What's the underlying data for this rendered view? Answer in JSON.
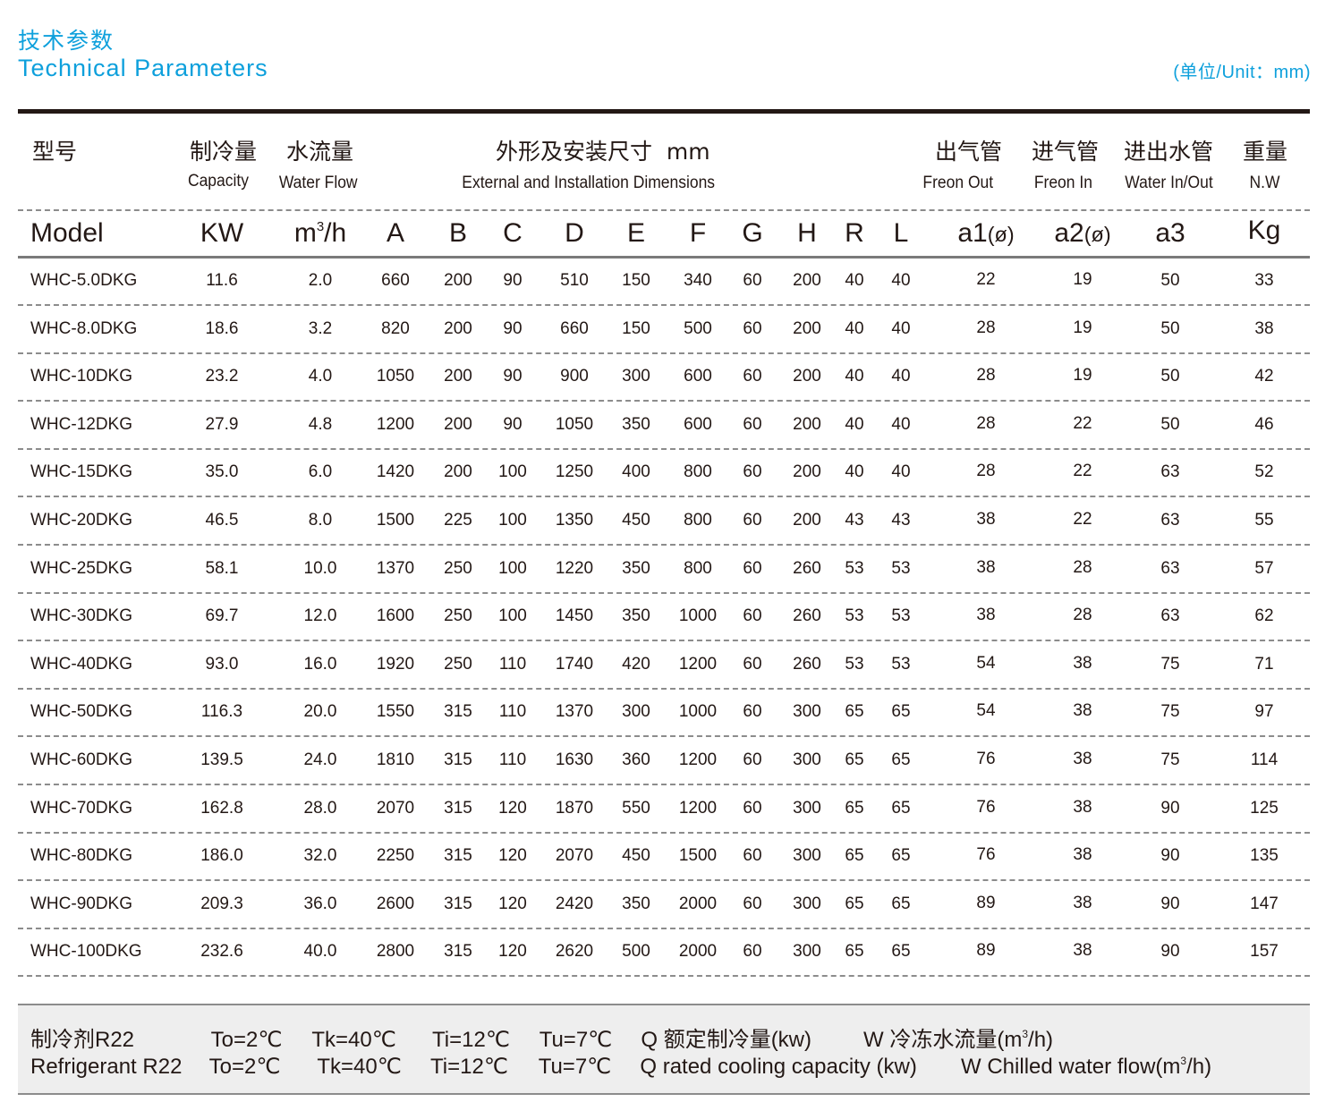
{
  "title": {
    "cn": "技术参数",
    "en": "Technical Parameters",
    "unit": "(单位/Unit：mm)"
  },
  "colors": {
    "accent": "#0ea0dc",
    "text": "#231815",
    "rule": "#231815",
    "divider": "#8c8c8c",
    "notes_bg": "#eeeeee"
  },
  "header": {
    "model_cn": "型号",
    "capacity_cn": "制冷量",
    "capacity_en": "Capacity",
    "waterflow_cn": "水流量",
    "waterflow_en": "Water Flow",
    "dimensions_cn": "外形及安装尺寸  mm",
    "dimensions_en": "External and Installation Dimensions",
    "freon_out_cn": "出气管",
    "freon_out_en": "Freon Out",
    "freon_in_cn": "进气管",
    "freon_in_en": "Freon In",
    "water_io_cn": "进出水管",
    "water_io_en": "Water In/Out",
    "weight_cn": "重量",
    "weight_en": "N.W",
    "symbols": {
      "model": "Model",
      "kw": "KW",
      "m3h_base": "m",
      "m3h_sup": "3",
      "m3h_tail": "/h",
      "A": "A",
      "B": "B",
      "C": "C",
      "D": "D",
      "E": "E",
      "F": "F",
      "G": "G",
      "H": "H",
      "R": "R",
      "L": "L",
      "a1": "a1",
      "a2": "a2",
      "phi": "(ø)",
      "a3": "a3",
      "kg": "Kg"
    }
  },
  "columns": [
    "Model",
    "KW",
    "m3/h",
    "A",
    "B",
    "C",
    "D",
    "E",
    "F",
    "G",
    "H",
    "R",
    "L",
    "a1(ø)",
    "a2(ø)",
    "a3",
    "Kg"
  ],
  "rows": [
    [
      "WHC-5.0DKG",
      "11.6",
      "2.0",
      "660",
      "200",
      "90",
      "510",
      "150",
      "340",
      "60",
      "200",
      "40",
      "40",
      "22",
      "19",
      "50",
      "33"
    ],
    [
      "WHC-8.0DKG",
      "18.6",
      "3.2",
      "820",
      "200",
      "90",
      "660",
      "150",
      "500",
      "60",
      "200",
      "40",
      "40",
      "28",
      "19",
      "50",
      "38"
    ],
    [
      "WHC-10DKG",
      "23.2",
      "4.0",
      "1050",
      "200",
      "90",
      "900",
      "300",
      "600",
      "60",
      "200",
      "40",
      "40",
      "28",
      "19",
      "50",
      "42"
    ],
    [
      "WHC-12DKG",
      "27.9",
      "4.8",
      "1200",
      "200",
      "90",
      "1050",
      "350",
      "600",
      "60",
      "200",
      "40",
      "40",
      "28",
      "22",
      "50",
      "46"
    ],
    [
      "WHC-15DKG",
      "35.0",
      "6.0",
      "1420",
      "200",
      "100",
      "1250",
      "400",
      "800",
      "60",
      "200",
      "40",
      "40",
      "28",
      "22",
      "63",
      "52"
    ],
    [
      "WHC-20DKG",
      "46.5",
      "8.0",
      "1500",
      "225",
      "100",
      "1350",
      "450",
      "800",
      "60",
      "200",
      "43",
      "43",
      "38",
      "22",
      "63",
      "55"
    ],
    [
      "WHC-25DKG",
      "58.1",
      "10.0",
      "1370",
      "250",
      "100",
      "1220",
      "350",
      "800",
      "60",
      "260",
      "53",
      "53",
      "38",
      "28",
      "63",
      "57"
    ],
    [
      "WHC-30DKG",
      "69.7",
      "12.0",
      "1600",
      "250",
      "100",
      "1450",
      "350",
      "1000",
      "60",
      "260",
      "53",
      "53",
      "38",
      "28",
      "63",
      "62"
    ],
    [
      "WHC-40DKG",
      "93.0",
      "16.0",
      "1920",
      "250",
      "110",
      "1740",
      "420",
      "1200",
      "60",
      "260",
      "53",
      "53",
      "54",
      "38",
      "75",
      "71"
    ],
    [
      "WHC-50DKG",
      "116.3",
      "20.0",
      "1550",
      "315",
      "110",
      "1370",
      "300",
      "1000",
      "60",
      "300",
      "65",
      "65",
      "54",
      "38",
      "75",
      "97"
    ],
    [
      "WHC-60DKG",
      "139.5",
      "24.0",
      "1810",
      "315",
      "110",
      "1630",
      "360",
      "1200",
      "60",
      "300",
      "65",
      "65",
      "76",
      "38",
      "75",
      "114"
    ],
    [
      "WHC-70DKG",
      "162.8",
      "28.0",
      "2070",
      "315",
      "120",
      "1870",
      "550",
      "1200",
      "60",
      "300",
      "65",
      "65",
      "76",
      "38",
      "90",
      "125"
    ],
    [
      "WHC-80DKG",
      "186.0",
      "32.0",
      "2250",
      "315",
      "120",
      "2070",
      "450",
      "1500",
      "60",
      "300",
      "65",
      "65",
      "76",
      "38",
      "90",
      "135"
    ],
    [
      "WHC-90DKG",
      "209.3",
      "36.0",
      "2600",
      "315",
      "120",
      "2420",
      "350",
      "2000",
      "60",
      "300",
      "65",
      "65",
      "89",
      "38",
      "90",
      "147"
    ],
    [
      "WHC-100DKG",
      "232.6",
      "40.0",
      "2800",
      "315",
      "120",
      "2620",
      "500",
      "2000",
      "60",
      "300",
      "65",
      "65",
      "89",
      "38",
      "90",
      "157"
    ]
  ],
  "notes": {
    "cn": {
      "refrigerant": "制冷剂R22",
      "to": "To=2℃",
      "tk": "Tk=40℃",
      "ti": "Ti=12℃",
      "tu": "Tu=7℃",
      "q": "Q 额定制冷量(kw)",
      "w_base": "W 冷冻水流量(m",
      "w_sup": "3",
      "w_tail": "/h)"
    },
    "en": {
      "refrigerant": "Refrigerant R22",
      "to": "To=2℃",
      "tk": "Tk=40℃",
      "ti": "Ti=12℃",
      "tu": "Tu=7℃",
      "q": "Q rated cooling capacity (kw)",
      "w_base": "W Chilled water flow(m",
      "w_sup": "3",
      "w_tail": "/h)"
    }
  }
}
